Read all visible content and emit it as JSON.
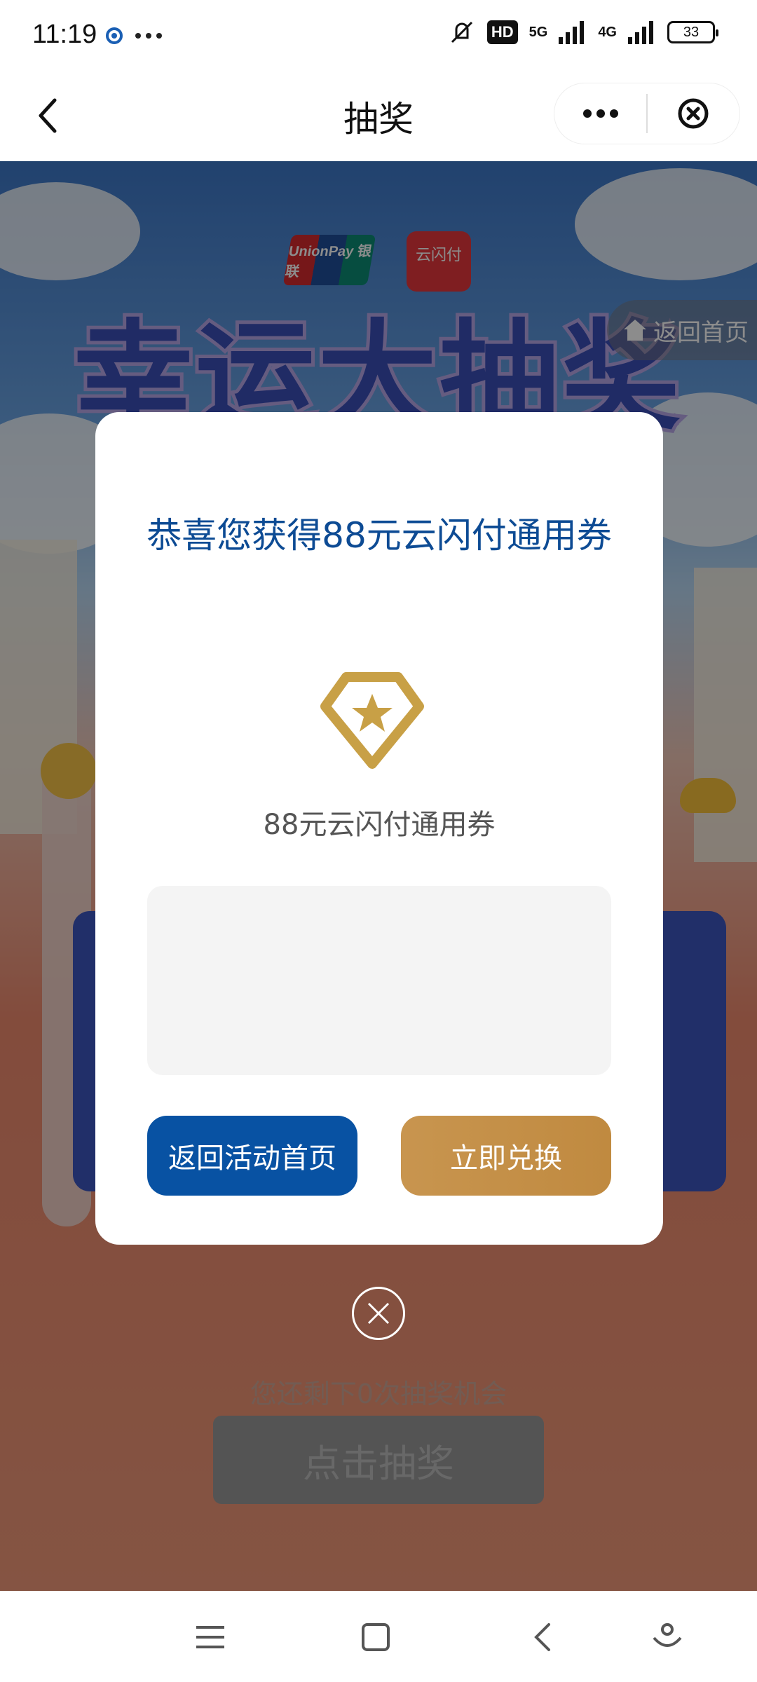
{
  "status_bar": {
    "time": "11:19",
    "hd_label": "HD",
    "net_5g": "5G",
    "net_4g": "4G",
    "battery": "33"
  },
  "nav": {
    "title": "抽奖",
    "back_icon": "chevron-left-icon",
    "more_icon": "more-dots-icon",
    "close_icon": "close-circle-icon"
  },
  "background_page": {
    "unionpay_logo_text": "UnionPay 银联",
    "yunshanfu_logo_text": "云闪付",
    "banner_title": "幸运大抽奖",
    "home_button_label": "返回首页",
    "remaining_text": "您还剩下0次抽奖机会",
    "draw_button_label": "点击抽奖"
  },
  "modal": {
    "title": "恭喜您获得88元云闪付通用券",
    "prize_icon": "diamond-star-icon",
    "prize_name": "88元云闪付通用券",
    "back_button_label": "返回活动首页",
    "redeem_button_label": "立即兑换",
    "close_icon": "close-circle-icon"
  },
  "colors": {
    "primary_blue": "#0852a3",
    "title_blue": "#0d4b94",
    "gold": "#c8954f"
  },
  "system_nav": {
    "menu_icon": "menu-icon",
    "home_icon": "square-home-icon",
    "back_icon": "back-chevron-icon",
    "assistant_icon": "assistant-icon"
  }
}
